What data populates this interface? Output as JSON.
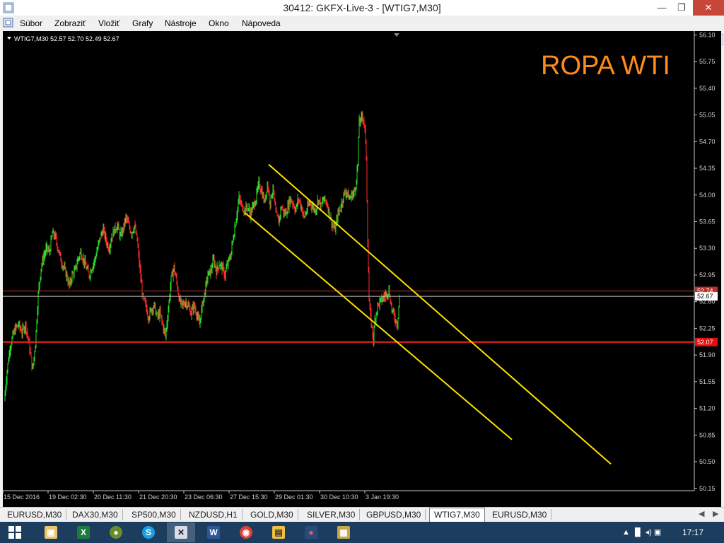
{
  "window": {
    "title": "30412: GKFX-Live-3 - [WTIG7,M30]",
    "min": "—",
    "max": "❐",
    "close": "✕"
  },
  "menu": [
    {
      "label": "Súbor"
    },
    {
      "label": "Zobraziť"
    },
    {
      "label": "Vložiť"
    },
    {
      "label": "Grafy"
    },
    {
      "label": "Nástroje"
    },
    {
      "label": "Okno"
    },
    {
      "label": "Nápoveda"
    }
  ],
  "chart": {
    "info_line": "WTIG7,M30  52.57 52.70 52.49 52.67",
    "overlay_text": "ROPA WTI",
    "current_price": "52.67",
    "red_level_label": "52.07",
    "upper_line_label": "52.74"
  },
  "chart_data": {
    "type": "candlestick",
    "symbol": "WTIG7",
    "timeframe": "M30",
    "ohlc_last": {
      "open": 52.57,
      "high": 52.7,
      "low": 52.49,
      "close": 52.67
    },
    "y_ticks": [
      "56.10",
      "55.75",
      "55.40",
      "55.05",
      "54.70",
      "54.35",
      "54.00",
      "53.65",
      "53.30",
      "52.95",
      "52.60",
      "52.25",
      "51.90",
      "51.55",
      "51.20",
      "50.85",
      "50.50",
      "50.15"
    ],
    "x_ticks": [
      "15 Dec 2016",
      "19 Dec 02:30",
      "20 Dec 11:30",
      "21 Dec 20:30",
      "23 Dec 06:30",
      "27 Dec 15:30",
      "29 Dec 01:30",
      "30 Dec 10:30",
      "3 Jan 19:30"
    ],
    "ylim": [
      50.12,
      56.15
    ],
    "horizontal_lines": [
      {
        "price": 52.07,
        "color": "#ff2020"
      },
      {
        "price": 52.74,
        "color": "#c0302a"
      },
      {
        "price": 52.67,
        "color": "#c8c8c8"
      }
    ],
    "trendlines": [
      {
        "from": [
          "27 Dec 15:30",
          54.4
        ],
        "to": [
          "3 Jan",
          50.47
        ],
        "color": "#ffe000"
      },
      {
        "from": [
          "27 Dec 12:00",
          53.77
        ],
        "to": [
          "3 Jan",
          50.79
        ],
        "color": "#ffe000"
      }
    ],
    "close_path": [
      [
        0,
        51.3
      ],
      [
        4,
        51.7
      ],
      [
        8,
        52.0
      ],
      [
        12,
        52.15
      ],
      [
        16,
        52.25
      ],
      [
        20,
        52.3
      ],
      [
        25,
        52.2
      ],
      [
        30,
        52.3
      ],
      [
        35,
        52.05
      ],
      [
        40,
        51.7
      ],
      [
        44,
        52.05
      ],
      [
        48,
        52.7
      ],
      [
        52,
        53.05
      ],
      [
        56,
        53.2
      ],
      [
        60,
        53.3
      ],
      [
        64,
        53.25
      ],
      [
        68,
        53.5
      ],
      [
        72,
        53.45
      ],
      [
        76,
        53.3
      ],
      [
        80,
        53.15
      ],
      [
        84,
        53.05
      ],
      [
        88,
        52.95
      ],
      [
        92,
        52.8
      ],
      [
        96,
        52.95
      ],
      [
        100,
        53.0
      ],
      [
        104,
        53.15
      ],
      [
        108,
        53.25
      ],
      [
        112,
        53.15
      ],
      [
        116,
        53.05
      ],
      [
        120,
        52.95
      ],
      [
        124,
        53.05
      ],
      [
        128,
        53.15
      ],
      [
        132,
        53.3
      ],
      [
        136,
        53.45
      ],
      [
        140,
        53.55
      ],
      [
        144,
        53.4
      ],
      [
        148,
        53.3
      ],
      [
        152,
        53.45
      ],
      [
        156,
        53.55
      ],
      [
        160,
        53.6
      ],
      [
        164,
        53.45
      ],
      [
        168,
        53.55
      ],
      [
        172,
        53.7
      ],
      [
        176,
        53.6
      ],
      [
        180,
        53.5
      ],
      [
        184,
        53.6
      ],
      [
        188,
        53.4
      ],
      [
        192,
        53.0
      ],
      [
        196,
        52.65
      ],
      [
        200,
        52.55
      ],
      [
        204,
        52.4
      ],
      [
        208,
        52.5
      ],
      [
        212,
        52.55
      ],
      [
        216,
        52.4
      ],
      [
        220,
        52.45
      ],
      [
        224,
        52.3
      ],
      [
        228,
        52.15
      ],
      [
        232,
        52.5
      ],
      [
        236,
        52.9
      ],
      [
        240,
        53.05
      ],
      [
        244,
        52.85
      ],
      [
        248,
        52.6
      ],
      [
        252,
        52.55
      ],
      [
        256,
        52.6
      ],
      [
        260,
        52.55
      ],
      [
        264,
        52.45
      ],
      [
        268,
        52.55
      ],
      [
        272,
        52.45
      ],
      [
        276,
        52.3
      ],
      [
        280,
        52.55
      ],
      [
        284,
        52.75
      ],
      [
        288,
        52.95
      ],
      [
        292,
        53.0
      ],
      [
        296,
        53.15
      ],
      [
        300,
        53.0
      ],
      [
        304,
        53.1
      ],
      [
        308,
        53.05
      ],
      [
        312,
        52.95
      ],
      [
        316,
        53.1
      ],
      [
        320,
        53.2
      ],
      [
        324,
        53.45
      ],
      [
        328,
        53.7
      ],
      [
        332,
        53.95
      ],
      [
        336,
        53.85
      ],
      [
        340,
        53.8
      ],
      [
        344,
        53.85
      ],
      [
        348,
        53.75
      ],
      [
        352,
        53.85
      ],
      [
        356,
        53.95
      ],
      [
        360,
        54.15
      ],
      [
        364,
        54.05
      ],
      [
        368,
        53.9
      ],
      [
        372,
        54.15
      ],
      [
        376,
        53.9
      ],
      [
        380,
        54.1
      ],
      [
        384,
        53.75
      ],
      [
        388,
        53.65
      ],
      [
        392,
        53.85
      ],
      [
        396,
        53.75
      ],
      [
        400,
        53.8
      ],
      [
        404,
        53.95
      ],
      [
        408,
        53.9
      ],
      [
        412,
        53.8
      ],
      [
        416,
        53.95
      ],
      [
        420,
        53.85
      ],
      [
        424,
        53.7
      ],
      [
        428,
        53.8
      ],
      [
        432,
        53.9
      ],
      [
        436,
        53.85
      ],
      [
        440,
        53.8
      ],
      [
        444,
        53.95
      ],
      [
        448,
        53.85
      ],
      [
        452,
        53.95
      ],
      [
        456,
        53.9
      ],
      [
        460,
        53.75
      ],
      [
        464,
        53.6
      ],
      [
        468,
        53.55
      ],
      [
        472,
        53.75
      ],
      [
        476,
        53.85
      ],
      [
        480,
        54.0
      ],
      [
        484,
        54.05
      ],
      [
        488,
        53.95
      ],
      [
        492,
        54.0
      ],
      [
        496,
        54.05
      ],
      [
        500,
        54.4
      ],
      [
        502,
        55.0
      ],
      [
        504,
        54.95
      ],
      [
        506,
        55.05
      ],
      [
        508,
        55.0
      ],
      [
        510,
        54.85
      ],
      [
        512,
        54.5
      ],
      [
        514,
        53.4
      ],
      [
        516,
        52.6
      ],
      [
        518,
        52.4
      ],
      [
        520,
        52.25
      ],
      [
        522,
        52.1
      ],
      [
        524,
        52.35
      ],
      [
        526,
        52.45
      ],
      [
        528,
        52.55
      ],
      [
        532,
        52.6
      ],
      [
        536,
        52.65
      ],
      [
        540,
        52.7
      ],
      [
        544,
        52.75
      ],
      [
        548,
        52.5
      ],
      [
        552,
        52.4
      ],
      [
        556,
        52.3
      ],
      [
        559,
        52.67
      ]
    ]
  },
  "tabs": [
    {
      "label": "EURUSD,M30"
    },
    {
      "label": "DAX30,M30"
    },
    {
      "label": "SP500,M30"
    },
    {
      "label": "NZDUSD,H1"
    },
    {
      "label": "GOLD,M30"
    },
    {
      "label": "SILVER,M30"
    },
    {
      "label": "GBPUSD,M30"
    },
    {
      "label": "WTIG7,M30"
    },
    {
      "label": "EURUSD,M30"
    }
  ],
  "tab_nav": {
    "left": "◀",
    "right": "▶"
  },
  "taskbar": {
    "apps": [
      {
        "icon": "explorer-icon"
      },
      {
        "icon": "excel-icon"
      },
      {
        "icon": "app-icon"
      },
      {
        "icon": "skype-icon"
      },
      {
        "icon": "metatrader-icon"
      },
      {
        "icon": "word-icon"
      },
      {
        "icon": "chrome-icon"
      },
      {
        "icon": "folder-icon"
      },
      {
        "icon": "color-app-icon"
      },
      {
        "icon": "media-app-icon"
      }
    ],
    "tray": "▲  ▐▌  ◂)  ▣",
    "time": "17:17"
  }
}
